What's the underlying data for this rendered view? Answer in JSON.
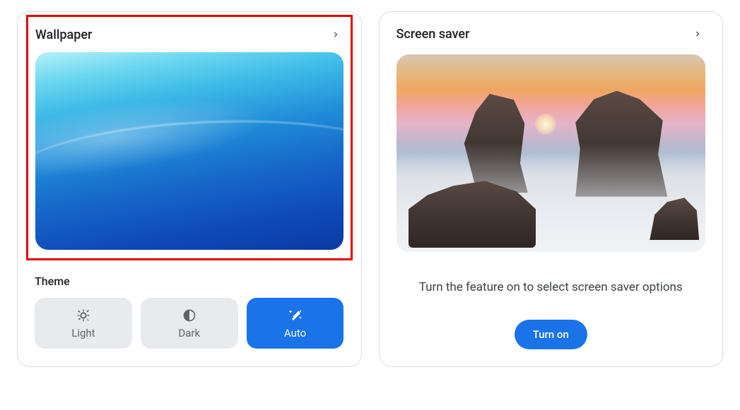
{
  "wallpaper": {
    "title": "Wallpaper"
  },
  "theme": {
    "section_label": "Theme",
    "options": {
      "light": "Light",
      "dark": "Dark",
      "auto": "Auto"
    }
  },
  "screensaver": {
    "title": "Screen saver",
    "description": "Turn the feature on to select screen saver options",
    "turn_on_label": "Turn on"
  }
}
